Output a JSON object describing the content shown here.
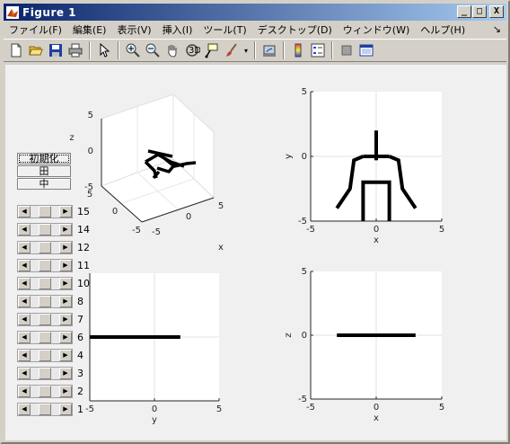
{
  "window": {
    "title": "Figure 1"
  },
  "title_buttons": {
    "minimize": "_",
    "maximize": "□",
    "close": "X"
  },
  "menu": {
    "items": [
      "ファイル(F)",
      "編集(E)",
      "表示(V)",
      "挿入(I)",
      "ツール(T)",
      "デスクトップ(D)",
      "ウィンドウ(W)",
      "ヘルプ(H)"
    ],
    "overflow_arrow": "↘"
  },
  "toolbar": {
    "icons": [
      "new-figure-icon",
      "open-icon",
      "save-icon",
      "print-icon",
      "pointer-icon",
      "zoom-in-icon",
      "zoom-out-icon",
      "pan-icon",
      "rotate-3d-icon",
      "data-cursor-icon",
      "brush-icon",
      "link-icon",
      "colorbar-icon",
      "legend-icon",
      "hide-plot-tools-icon",
      "show-plot-tools-icon"
    ]
  },
  "buttons": {
    "init": "初期化",
    "top": "田",
    "mid": "中"
  },
  "sliders": [
    {
      "label": "15",
      "value": 0.5
    },
    {
      "label": "14",
      "value": 0.5
    },
    {
      "label": "12",
      "value": 0.5
    },
    {
      "label": "11",
      "value": 0.5
    },
    {
      "label": "10",
      "value": 0.5
    },
    {
      "label": "8",
      "value": 0.5
    },
    {
      "label": "7",
      "value": 0.5
    },
    {
      "label": "6",
      "value": 0.5
    },
    {
      "label": "4",
      "value": 0.5
    },
    {
      "label": "3",
      "value": 0.5
    },
    {
      "label": "2",
      "value": 0.5
    },
    {
      "label": "1",
      "value": 0.5
    }
  ],
  "chart_data": [
    {
      "type": "line",
      "view": "3d",
      "xlabel": "x",
      "ylabel": "",
      "zlabel": "z",
      "xticks": [
        "-5",
        "0",
        "5"
      ],
      "yticks": [
        "-5",
        "0",
        "5"
      ],
      "zticks": [
        "-5",
        "0",
        "5"
      ],
      "grid": true
    },
    {
      "type": "line",
      "xlabel": "x",
      "ylabel": "y",
      "xlim": [
        -5,
        5
      ],
      "ylim": [
        -5,
        5
      ],
      "xticks": [
        "-5",
        "0",
        "5"
      ],
      "yticks": [
        "-5",
        "0",
        "5"
      ],
      "grid": true,
      "segments": [
        [
          [
            0,
            2
          ],
          [
            0,
            -0.3
          ]
        ],
        [
          [
            -1,
            0
          ],
          [
            1,
            0
          ]
        ],
        [
          [
            -1,
            0
          ],
          [
            -1.7,
            -0.3
          ],
          [
            -2,
            -2.5
          ],
          [
            -3,
            -4
          ]
        ],
        [
          [
            1,
            0
          ],
          [
            1.7,
            -0.3
          ],
          [
            2,
            -2.5
          ],
          [
            3,
            -4
          ]
        ],
        [
          [
            -1,
            -5
          ],
          [
            -1,
            -2
          ],
          [
            1,
            -2
          ],
          [
            1,
            -5
          ]
        ]
      ]
    },
    {
      "type": "line",
      "xlabel": "y",
      "ylabel": "",
      "xlim": [
        -5,
        5
      ],
      "ylim": [
        -5,
        5
      ],
      "xticks": [
        "-5",
        "0",
        "5"
      ],
      "yticks": [],
      "grid": true,
      "segments": [
        [
          [
            -5,
            0
          ],
          [
            2,
            0
          ]
        ]
      ]
    },
    {
      "type": "line",
      "xlabel": "x",
      "ylabel": "z",
      "xlim": [
        -5,
        5
      ],
      "ylim": [
        -5,
        5
      ],
      "xticks": [
        "-5",
        "0",
        "5"
      ],
      "yticks": [
        "-5",
        "0",
        "5"
      ],
      "grid": true,
      "segments": [
        [
          [
            -3,
            0
          ],
          [
            3,
            0
          ]
        ]
      ]
    }
  ]
}
